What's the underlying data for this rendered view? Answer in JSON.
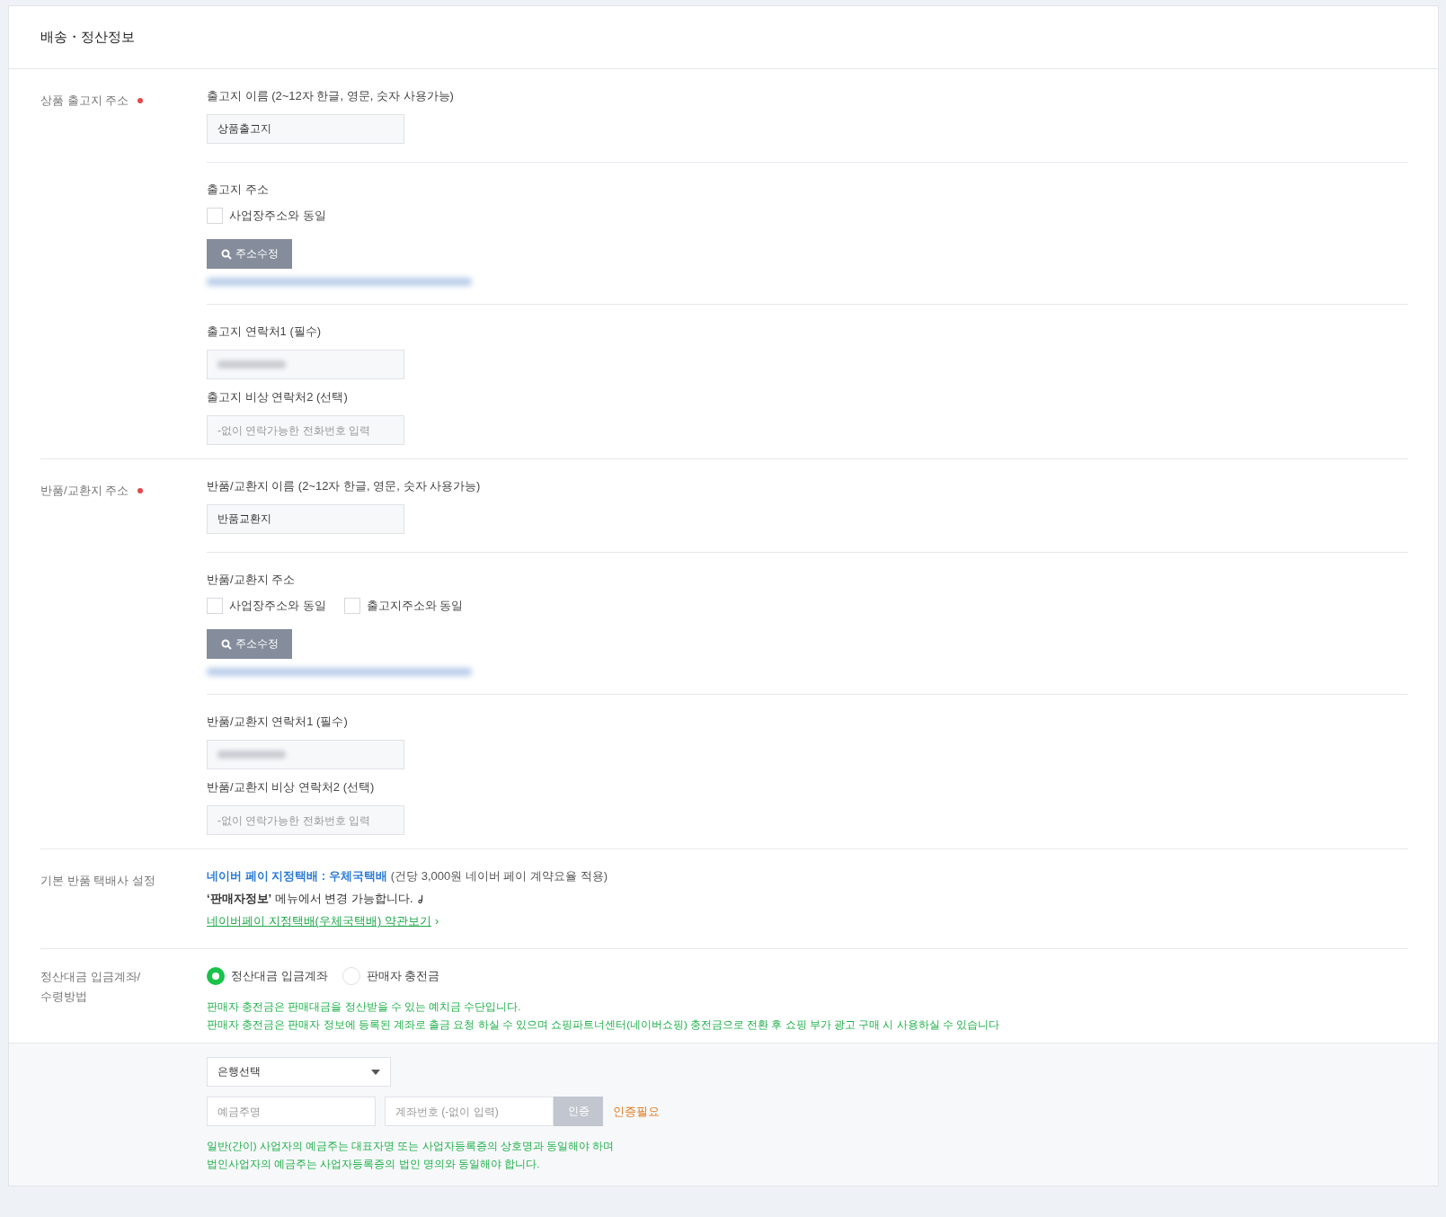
{
  "page": {
    "title": "배송・정산정보"
  },
  "shipping_address": {
    "label": "상품 출고지 주소",
    "required": true,
    "name_label": "출고지 이름 (2~12자 한글, 영문, 숫자 사용가능)",
    "name_value": "상품출고지",
    "address_label": "출고지 주소",
    "checkboxes": [
      {
        "label": "사업장주소와 동일",
        "checked": false
      }
    ],
    "button": "주소수정",
    "contact1_label": "출고지 연락처1 (필수)",
    "contact2_label": "출고지 비상 연락처2 (선택)",
    "contact2_placeholder": "-없이 연락가능한 전화번호 입력"
  },
  "return_address": {
    "label": "반품/교환지 주소",
    "required": true,
    "name_label": "반품/교환지 이름 (2~12자 한글, 영문, 숫자 사용가능)",
    "name_value": "반품교환지",
    "address_label": "반품/교환지 주소",
    "checkboxes": [
      {
        "label": "사업장주소와 동일",
        "checked": false
      },
      {
        "label": "출고지주소와 동일",
        "checked": false
      }
    ],
    "button": "주소수정",
    "contact1_label": "반품/교환지 연락처1 (필수)",
    "contact2_label": "반품/교환지 비상 연락처2 (선택)",
    "contact2_placeholder": "-없이 연락가능한 전화번호 입력"
  },
  "default_courier": {
    "label": "기본 반품 택배사 설정",
    "carrier": "네이버 페이 지정택배 : 우체국택배",
    "carrier_note": "(건당 3,000원 네이버 페이 계약요율 적용)",
    "change_note": "**‘판매자정보’** 메뉴에서 변경 가능합니다.",
    "terms_link": "네이버페이 지정택배(우체국택배) 약관보기",
    "terms_chevron": "›"
  },
  "settlement": {
    "label_lines": [
      "정산대금 입금계좌/",
      "수령방법"
    ],
    "radios": [
      {
        "label": "정산대금 입금계좌",
        "selected": true
      },
      {
        "label": "판매자 충전금",
        "selected": false
      }
    ],
    "notes": [
      "판매자 충전금은 판매대금을 정산받을 수 있는 예치금 수단입니다.",
      "판매자 충전금은 판매자 정보에 등록된 계좌로 출금 요청 하실 수 있으며 쇼핑파트너센터(네이버쇼핑) 충전금으로 전환 후 쇼핑 부가 광고 구매 시 사용하실 수 있습니다"
    ],
    "bank_select": "은행선택",
    "holder_placeholder": "예금주명",
    "account_placeholder": "계좌번호 (-없이 입력)",
    "verify_button": "인증",
    "verify_status": "인증필요",
    "account_notes": [
      "일반(간이) 사업자의 예금주는 대표자명 또는 사업자등록증의 상호명과 동일해야 하며",
      "법인사업자의 예금주는 사업자등록증의 법인 명의와 동일해야 합니다."
    ]
  }
}
